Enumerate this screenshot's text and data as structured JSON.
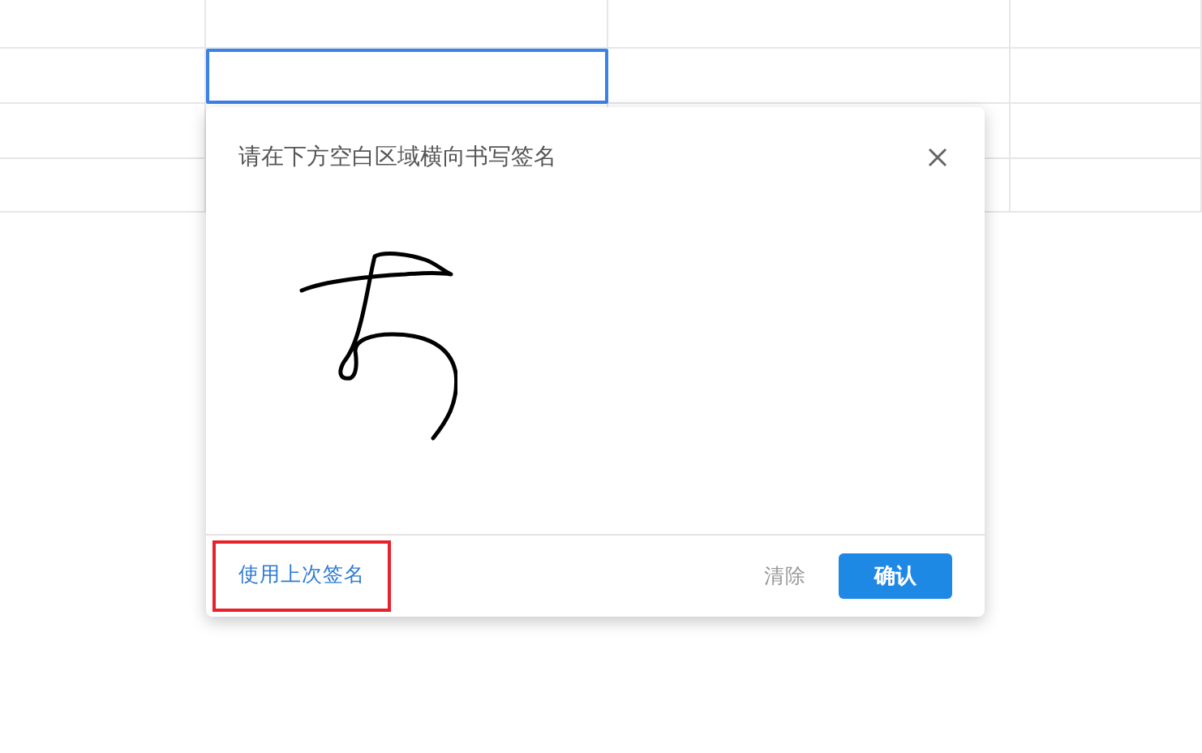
{
  "sheet": {
    "rows": [
      [
        {
          "selected": false
        },
        {
          "selected": false
        },
        {
          "selected": false
        },
        {
          "selected": false
        }
      ],
      [
        {
          "selected": false
        },
        {
          "selected": true
        },
        {
          "selected": false
        },
        {
          "selected": false
        }
      ],
      [
        {
          "selected": false
        },
        {},
        {
          "selected": false
        },
        {
          "selected": false
        }
      ],
      [
        {
          "selected": false
        },
        {},
        {
          "selected": false
        },
        {
          "selected": false
        }
      ]
    ]
  },
  "dialog": {
    "title": "请在下方空白区域横向书写签名",
    "footer": {
      "use_last": {
        "label": "使用上次签名",
        "highlighted": true
      },
      "clear": "清除",
      "confirm": "确认"
    }
  }
}
